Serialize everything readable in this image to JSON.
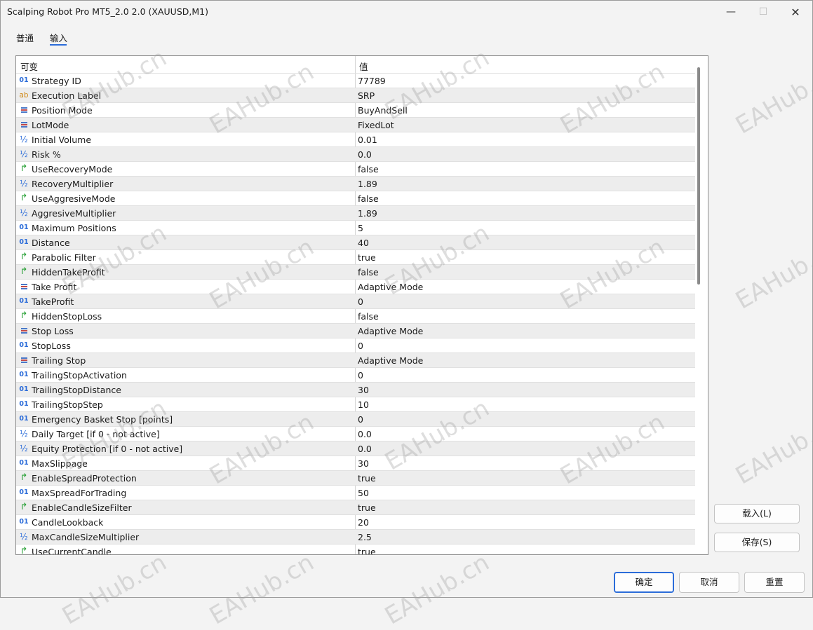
{
  "window": {
    "title": "Scalping Robot Pro MT5_2.0 2.0 (XAUUSD,M1)",
    "min_glyph": "—",
    "max_glyph": "☐",
    "close_glyph": "✕"
  },
  "tabs": [
    {
      "label": "普通",
      "active": false
    },
    {
      "label": "输入",
      "active": true
    }
  ],
  "grid": {
    "headers": {
      "variable": "可变",
      "value": "值"
    },
    "rows": [
      {
        "icon": "integer-icon",
        "glyph": "01",
        "name": "Strategy ID",
        "value": "77789"
      },
      {
        "icon": "string-icon",
        "glyph": "ab",
        "name": "Execution Label",
        "value": "SRP"
      },
      {
        "icon": "enum-icon",
        "glyph": "",
        "name": "Position Mode",
        "value": "BuyAndSell"
      },
      {
        "icon": "enum-icon",
        "glyph": "",
        "name": "LotMode",
        "value": "FixedLot"
      },
      {
        "icon": "double-icon",
        "glyph": "½",
        "name": "Initial Volume",
        "value": "0.01"
      },
      {
        "icon": "double-icon",
        "glyph": "½",
        "name": "Risk %",
        "value": "0.0"
      },
      {
        "icon": "bool-icon",
        "glyph": "↱",
        "name": "UseRecoveryMode",
        "value": "false"
      },
      {
        "icon": "double-icon",
        "glyph": "½",
        "name": "RecoveryMultiplier",
        "value": "1.89"
      },
      {
        "icon": "bool-icon",
        "glyph": "↱",
        "name": "UseAggresiveMode",
        "value": "false"
      },
      {
        "icon": "double-icon",
        "glyph": "½",
        "name": "AggresiveMultiplier",
        "value": "1.89"
      },
      {
        "icon": "integer-icon",
        "glyph": "01",
        "name": "Maximum Positions",
        "value": "5"
      },
      {
        "icon": "integer-icon",
        "glyph": "01",
        "name": "Distance",
        "value": "40"
      },
      {
        "icon": "bool-icon",
        "glyph": "↱",
        "name": "Parabolic Filter",
        "value": "true"
      },
      {
        "icon": "bool-icon",
        "glyph": "↱",
        "name": "HiddenTakeProfit",
        "value": "false"
      },
      {
        "icon": "enum-icon",
        "glyph": "",
        "name": "Take Profit",
        "value": "Adaptive Mode"
      },
      {
        "icon": "integer-icon",
        "glyph": "01",
        "name": "TakeProfit",
        "value": "0"
      },
      {
        "icon": "bool-icon",
        "glyph": "↱",
        "name": "HiddenStopLoss",
        "value": "false"
      },
      {
        "icon": "enum-icon",
        "glyph": "",
        "name": "Stop Loss",
        "value": "Adaptive Mode"
      },
      {
        "icon": "integer-icon",
        "glyph": "01",
        "name": "StopLoss",
        "value": "0"
      },
      {
        "icon": "enum-icon",
        "glyph": "",
        "name": "Trailing Stop",
        "value": "Adaptive Mode"
      },
      {
        "icon": "integer-icon",
        "glyph": "01",
        "name": "TrailingStopActivation",
        "value": "0"
      },
      {
        "icon": "integer-icon",
        "glyph": "01",
        "name": "TrailingStopDistance",
        "value": "30"
      },
      {
        "icon": "integer-icon",
        "glyph": "01",
        "name": "TrailingStopStep",
        "value": "10"
      },
      {
        "icon": "integer-icon",
        "glyph": "01",
        "name": "Emergency Basket Stop [points]",
        "value": "0"
      },
      {
        "icon": "double-icon",
        "glyph": "½",
        "name": "Daily Target [if 0 - not active]",
        "value": "0.0"
      },
      {
        "icon": "double-icon",
        "glyph": "½",
        "name": "Equity Protection [if 0 - not active]",
        "value": "0.0"
      },
      {
        "icon": "integer-icon",
        "glyph": "01",
        "name": "MaxSlippage",
        "value": "30"
      },
      {
        "icon": "bool-icon",
        "glyph": "↱",
        "name": "EnableSpreadProtection",
        "value": "true"
      },
      {
        "icon": "integer-icon",
        "glyph": "01",
        "name": "MaxSpreadForTrading",
        "value": "50"
      },
      {
        "icon": "bool-icon",
        "glyph": "↱",
        "name": "EnableCandleSizeFilter",
        "value": "true"
      },
      {
        "icon": "integer-icon",
        "glyph": "01",
        "name": "CandleLookback",
        "value": "20"
      },
      {
        "icon": "double-icon",
        "glyph": "½",
        "name": "MaxCandleSizeMultiplier",
        "value": "2.5"
      },
      {
        "icon": "bool-icon",
        "glyph": "↱",
        "name": "UseCurrentCandle",
        "value": "true"
      }
    ]
  },
  "side_buttons": {
    "load": "载入(L)",
    "save": "保存(S)"
  },
  "bottom_buttons": {
    "ok": "确定",
    "cancel": "取消",
    "reset": "重置"
  },
  "watermark_text": "EAHub.cn",
  "colors": {
    "accent": "#2b6cd9",
    "bool_icon": "#27a035",
    "string_icon": "#d08a1a",
    "alt_row": "#ededed"
  }
}
